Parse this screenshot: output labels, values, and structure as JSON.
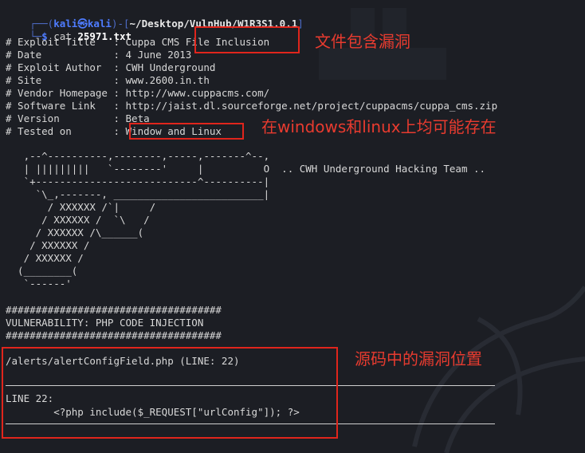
{
  "prompt": {
    "user": "kali",
    "skull": "㉿",
    "host": "kali",
    "path": "~/Desktop/VulnHub/W1R3S1.0.1",
    "symbol": "$",
    "command": "cat",
    "argument": "25971.txt"
  },
  "header_lines": [
    "# Exploit Title   : Cuppa CMS File Inclusion",
    "# Date            : 4 June 2013",
    "# Exploit Author  : CWH Underground",
    "# Site            : www.2600.in.th",
    "# Vendor Homepage : http://www.cuppacms.com/",
    "# Software Link   : http://jaist.dl.sourceforge.net/project/cuppacms/cuppa_cms.zip",
    "# Version         : Beta",
    "# Tested on       : Window and Linux"
  ],
  "ascii_art": "   ,--^----------,--------,-----,-------^--,\n   | |||||||||   `--------'     |          O  .. CWH Underground Hacking Team ..\n   `+---------------------------^----------|\n     `\\_,-------, _________________________|\n       / XXXXXX /`|     /\n      / XXXXXX /  `\\   /\n     / XXXXXX /\\______(\n    / XXXXXX /\n   / XXXXXX /\n  (________(\n   `------'",
  "separator": "####################################",
  "vulnerability": "VULNERABILITY: PHP CODE INJECTION",
  "source_file": "/alerts/alertConfigField.php (LINE: 22)",
  "line_label": "LINE 22:",
  "code": "        <?php include($_REQUEST[\"urlConfig\"]); ?>",
  "annotations": {
    "file_inclusion": "文件包含漏洞",
    "tested_on": "在windows和linux上均可能存在",
    "source_location": "源码中的漏洞位置"
  },
  "colors": {
    "background": "#1c1e24",
    "prompt_blue": "#4e7cff",
    "annotation_red": "#e0251c",
    "text": "#d8d8d8"
  }
}
